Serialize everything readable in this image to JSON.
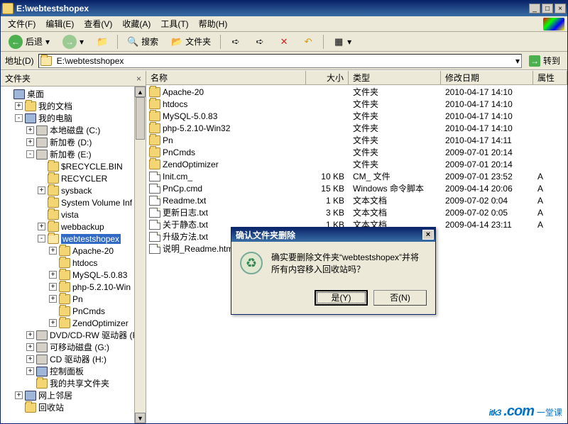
{
  "window": {
    "title": "E:\\webtestshopex"
  },
  "menu": [
    "文件(F)",
    "编辑(E)",
    "查看(V)",
    "收藏(A)",
    "工具(T)",
    "帮助(H)"
  ],
  "toolbar": {
    "back": "后退",
    "search": "搜索",
    "folders": "文件夹"
  },
  "address": {
    "label": "地址(D)",
    "value": "E:\\webtestshopex",
    "go": "转到"
  },
  "sidebar": {
    "title": "文件夹"
  },
  "tree": [
    {
      "indent": 0,
      "exp": "",
      "ico": "comp",
      "label": "桌面"
    },
    {
      "indent": 1,
      "exp": "+",
      "ico": "folder",
      "label": "我的文档"
    },
    {
      "indent": 1,
      "exp": "-",
      "ico": "comp",
      "label": "我的电脑"
    },
    {
      "indent": 2,
      "exp": "+",
      "ico": "drive",
      "label": "本地磁盘 (C:)"
    },
    {
      "indent": 2,
      "exp": "+",
      "ico": "drive",
      "label": "新加卷 (D:)"
    },
    {
      "indent": 2,
      "exp": "-",
      "ico": "drive",
      "label": "新加卷 (E:)"
    },
    {
      "indent": 3,
      "exp": "",
      "ico": "folder",
      "label": "$RECYCLE.BIN"
    },
    {
      "indent": 3,
      "exp": "",
      "ico": "folder",
      "label": "RECYCLER"
    },
    {
      "indent": 3,
      "exp": "+",
      "ico": "folder",
      "label": "sysback"
    },
    {
      "indent": 3,
      "exp": "",
      "ico": "folder",
      "label": "System Volume Inf"
    },
    {
      "indent": 3,
      "exp": "",
      "ico": "folder",
      "label": "vista"
    },
    {
      "indent": 3,
      "exp": "+",
      "ico": "folder",
      "label": "webbackup"
    },
    {
      "indent": 3,
      "exp": "-",
      "ico": "folder-open",
      "label": "webtestshopex",
      "sel": true
    },
    {
      "indent": 4,
      "exp": "+",
      "ico": "folder",
      "label": "Apache-20"
    },
    {
      "indent": 4,
      "exp": "",
      "ico": "folder",
      "label": "htdocs"
    },
    {
      "indent": 4,
      "exp": "+",
      "ico": "folder",
      "label": "MySQL-5.0.83"
    },
    {
      "indent": 4,
      "exp": "+",
      "ico": "folder",
      "label": "php-5.2.10-Win"
    },
    {
      "indent": 4,
      "exp": "+",
      "ico": "folder",
      "label": "Pn"
    },
    {
      "indent": 4,
      "exp": "",
      "ico": "folder",
      "label": "PnCmds"
    },
    {
      "indent": 4,
      "exp": "+",
      "ico": "folder",
      "label": "ZendOptimizer"
    },
    {
      "indent": 2,
      "exp": "+",
      "ico": "drive",
      "label": "DVD/CD-RW 驱动器 (F:"
    },
    {
      "indent": 2,
      "exp": "+",
      "ico": "drive",
      "label": "可移动磁盘 (G:)"
    },
    {
      "indent": 2,
      "exp": "+",
      "ico": "drive",
      "label": "CD 驱动器 (H:)"
    },
    {
      "indent": 2,
      "exp": "+",
      "ico": "comp",
      "label": "控制面板"
    },
    {
      "indent": 2,
      "exp": "",
      "ico": "folder",
      "label": "我的共享文件夹"
    },
    {
      "indent": 1,
      "exp": "+",
      "ico": "comp",
      "label": "网上邻居"
    },
    {
      "indent": 1,
      "exp": "",
      "ico": "folder",
      "label": "回收站"
    }
  ],
  "columns": {
    "name": "名称",
    "size": "大小",
    "type": "类型",
    "date": "修改日期",
    "attr": "属性"
  },
  "files": [
    {
      "ico": "folder",
      "name": "Apache-20",
      "size": "",
      "type": "文件夹",
      "date": "2010-04-17 14:10",
      "attr": ""
    },
    {
      "ico": "folder",
      "name": "htdocs",
      "size": "",
      "type": "文件夹",
      "date": "2010-04-17 14:10",
      "attr": ""
    },
    {
      "ico": "folder",
      "name": "MySQL-5.0.83",
      "size": "",
      "type": "文件夹",
      "date": "2010-04-17 14:10",
      "attr": ""
    },
    {
      "ico": "folder",
      "name": "php-5.2.10-Win32",
      "size": "",
      "type": "文件夹",
      "date": "2010-04-17 14:10",
      "attr": ""
    },
    {
      "ico": "folder",
      "name": "Pn",
      "size": "",
      "type": "文件夹",
      "date": "2010-04-17 14:11",
      "attr": ""
    },
    {
      "ico": "folder",
      "name": "PnCmds",
      "size": "",
      "type": "文件夹",
      "date": "2009-07-01 20:14",
      "attr": ""
    },
    {
      "ico": "folder",
      "name": "ZendOptimizer",
      "size": "",
      "type": "文件夹",
      "date": "2009-07-01 20:14",
      "attr": ""
    },
    {
      "ico": "file",
      "name": "Init.cm_",
      "size": "10 KB",
      "type": "CM_ 文件",
      "date": "2009-07-01 23:52",
      "attr": "A"
    },
    {
      "ico": "file",
      "name": "PnCp.cmd",
      "size": "15 KB",
      "type": "Windows 命令脚本",
      "date": "2009-04-14 20:06",
      "attr": "A"
    },
    {
      "ico": "file",
      "name": "Readme.txt",
      "size": "1 KB",
      "type": "文本文档",
      "date": "2009-07-02 0:04",
      "attr": "A"
    },
    {
      "ico": "file",
      "name": "更新日志.txt",
      "size": "3 KB",
      "type": "文本文档",
      "date": "2009-07-02 0:05",
      "attr": "A"
    },
    {
      "ico": "file",
      "name": "关于静态.txt",
      "size": "1 KB",
      "type": "文本文档",
      "date": "2009-04-14 23:11",
      "attr": "A"
    },
    {
      "ico": "file",
      "name": "升级方法.txt",
      "size": "",
      "type": "",
      "date": "",
      "attr": ""
    },
    {
      "ico": "file",
      "name": "说明_Readme.htm",
      "size": "",
      "type": "",
      "date": "",
      "attr": ""
    }
  ],
  "dialog": {
    "title": "确认文件夹删除",
    "message": "确实要删除文件夹“webtestshopex”并将所有内容移入回收站吗？",
    "yes": "是(Y)",
    "no": "否(N)"
  },
  "watermark": {
    "main": "itk3",
    "dom": ".com",
    "sub": "一堂课"
  }
}
